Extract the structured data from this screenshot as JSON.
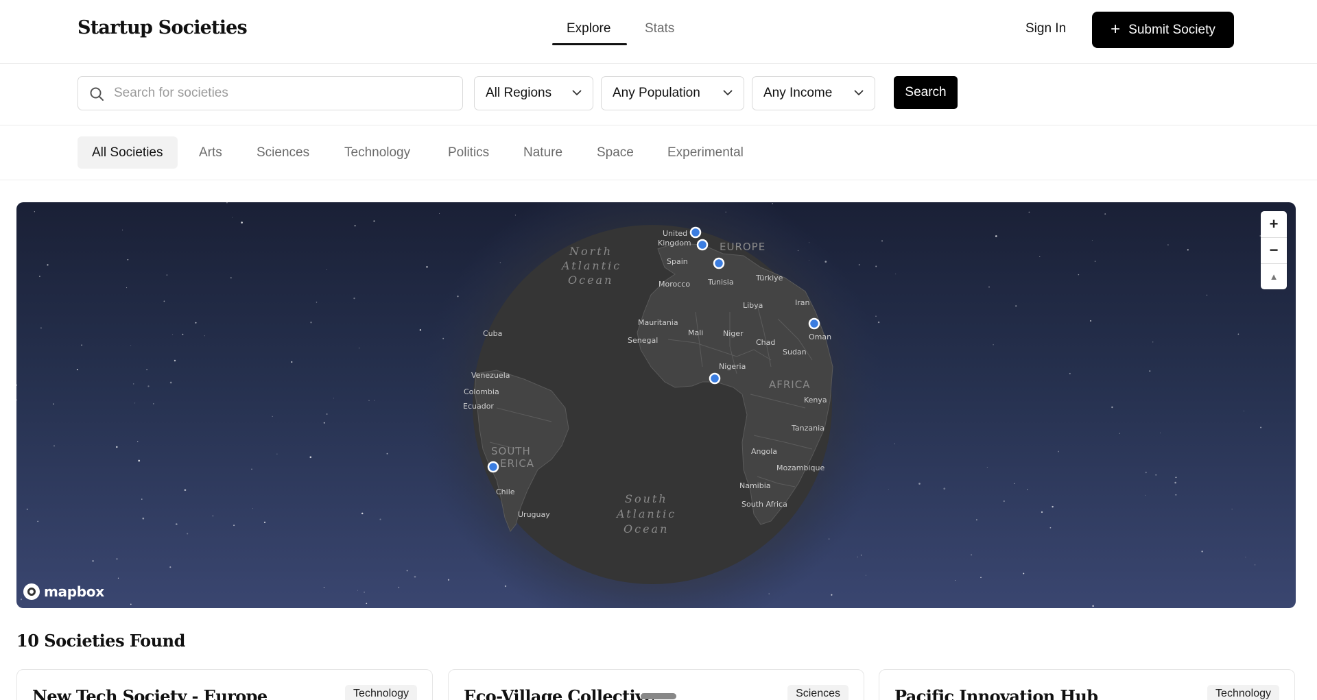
{
  "header": {
    "logo": "Startup Societies",
    "tabs": [
      {
        "label": "Explore",
        "active": true
      },
      {
        "label": "Stats",
        "active": false
      }
    ],
    "sign_in": "Sign In",
    "submit_label": "Submit Society"
  },
  "search": {
    "placeholder": "Search for societies",
    "value": "",
    "filters": [
      {
        "selected": "All Regions"
      },
      {
        "selected": "Any Population"
      },
      {
        "selected": "Any Income"
      }
    ],
    "button": "Search"
  },
  "categories": [
    {
      "label": "All Societies",
      "active": true
    },
    {
      "label": "Arts",
      "active": false
    },
    {
      "label": "Sciences",
      "active": false
    },
    {
      "label": "Technology",
      "active": false
    },
    {
      "label": "Politics",
      "active": false
    },
    {
      "label": "Nature",
      "active": false
    },
    {
      "label": "Space",
      "active": false
    },
    {
      "label": "Experimental",
      "active": false
    }
  ],
  "map": {
    "attribution": "mapbox",
    "zoom_in": "+",
    "zoom_out": "−",
    "compass": "▲",
    "marker_color": "#3b7de0",
    "labels": {
      "united_kingdom_1": "United",
      "united_kingdom_2": "Kingdom",
      "spain": "Spain",
      "morocco": "Morocco",
      "tunisia": "Tunisia",
      "turkiye": "Türkiye",
      "libya": "Libya",
      "iran": "Iran",
      "oman": "Oman",
      "mauritania": "Mauritania",
      "mali": "Mali",
      "niger": "Niger",
      "chad": "Chad",
      "sudan": "Sudan",
      "senegal": "Senegal",
      "nigeria": "Nigeria",
      "cuba": "Cuba",
      "venezuela": "Venezuela",
      "colombia": "Colombia",
      "ecuador": "Ecuador",
      "kenya": "Kenya",
      "tanzania": "Tanzania",
      "angola": "Angola",
      "mozambique": "Mozambique",
      "namibia": "Namibia",
      "south_africa": "South Africa",
      "chile": "Chile",
      "uruguay": "Uruguay",
      "europe": "EUROPE",
      "africa": "AFRICA",
      "south_america_1": "SOUTH",
      "south_america_2": "ERICA",
      "north_atlantic_1": "North",
      "north_atlantic_2": "Atlantic",
      "north_atlantic_3": "Ocean",
      "south_atlantic_1": "South",
      "south_atlantic_2": "Atlantic",
      "south_atlantic_3": "Ocean"
    }
  },
  "results": {
    "title": "10 Societies Found",
    "cards": [
      {
        "title": "New Tech Society - Europe",
        "category": "Technology"
      },
      {
        "title": "Eco-Village Collective",
        "category": "Sciences"
      },
      {
        "title": "Pacific Innovation Hub",
        "category": "Technology"
      }
    ]
  }
}
